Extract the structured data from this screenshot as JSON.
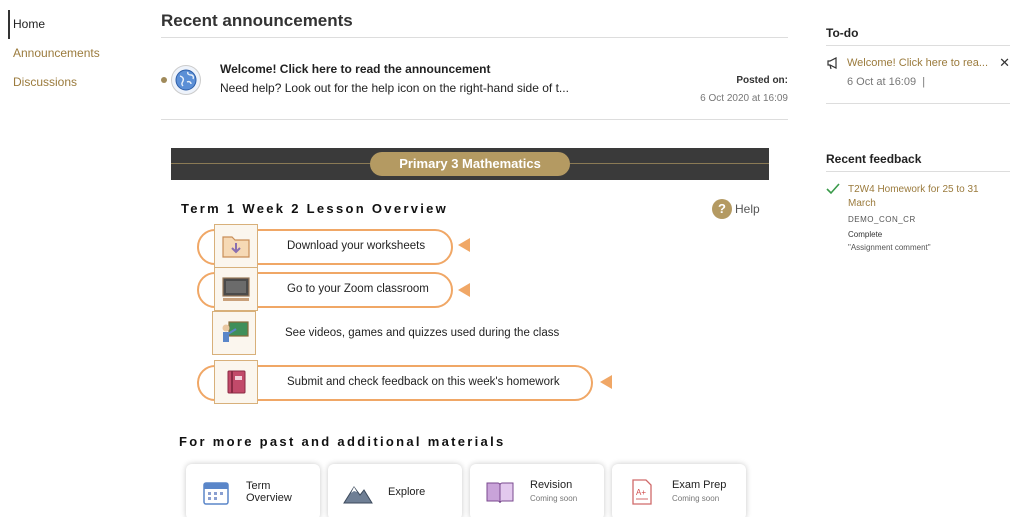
{
  "nav": {
    "items": [
      {
        "label": "Home"
      },
      {
        "label": "Announcements"
      },
      {
        "label": "Discussions"
      }
    ]
  },
  "announcements": {
    "heading": "Recent announcements",
    "item": {
      "title": "Welcome! Click here to read the announcement",
      "snippet": "Need help? Look out for the help icon on the right-hand side of t...",
      "posted_label": "Posted on:",
      "posted_date": "6 Oct 2020 at 16:09"
    }
  },
  "banner": {
    "label": "Primary 3 Mathematics"
  },
  "lesson": {
    "title": "Term 1 Week 2 Lesson Overview",
    "help_label": "Help",
    "items": [
      {
        "label": "Download your worksheets",
        "icon": "folder-download-icon"
      },
      {
        "label": "Go to your Zoom classroom",
        "icon": "computer-screen-icon"
      },
      {
        "label": "See videos, games and quizzes used during the class",
        "icon": "teacher-board-icon"
      },
      {
        "label": "Submit and check feedback on this week's homework",
        "icon": "homework-book-icon"
      }
    ]
  },
  "materials": {
    "title": "For more past and additional materials",
    "cards": [
      {
        "title": "Term",
        "title2": "Overview",
        "sub": "",
        "icon": "calendar-icon"
      },
      {
        "title": "Explore",
        "sub": "",
        "icon": "mountain-icon"
      },
      {
        "title": "Revision",
        "sub": "Coming soon",
        "icon": "open-book-icon"
      },
      {
        "title": "Exam Prep",
        "sub": "Coming soon",
        "icon": "exam-paper-icon"
      }
    ]
  },
  "todo": {
    "heading": "To-do",
    "item": {
      "label": "Welcome! Click here to rea...",
      "date": "6 Oct at 16:09",
      "separator": "|",
      "close": "✕"
    }
  },
  "feedback": {
    "heading": "Recent feedback",
    "item": {
      "title": "T2W4 Homework for 25 to 31 March",
      "code": "DEMO_CON_CR",
      "status": "Complete",
      "comment": "\"Assignment comment\""
    }
  },
  "colors": {
    "accent": "#b49a62",
    "link": "#9b7b3d",
    "highlight": "#f0a766",
    "banner_bg": "#3a3a3a"
  }
}
